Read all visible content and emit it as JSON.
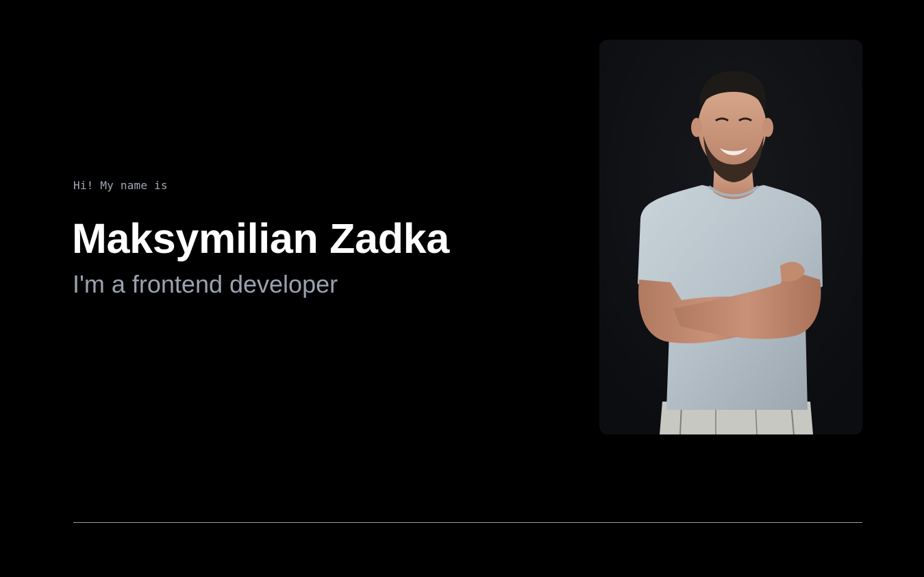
{
  "hero": {
    "greeting": "Hi! My name is",
    "name": "Maksymilian Zadka",
    "role": "I'm a frontend developer"
  },
  "portrait": {
    "subject": "smiling man with beard in light grey t-shirt, arms crossed, dark background"
  },
  "colors": {
    "background": "#000000",
    "name_text": "#ffffff",
    "muted_text": "#9ba1ae",
    "card_background": "#0f1013",
    "divider": "#9aa0ab"
  }
}
